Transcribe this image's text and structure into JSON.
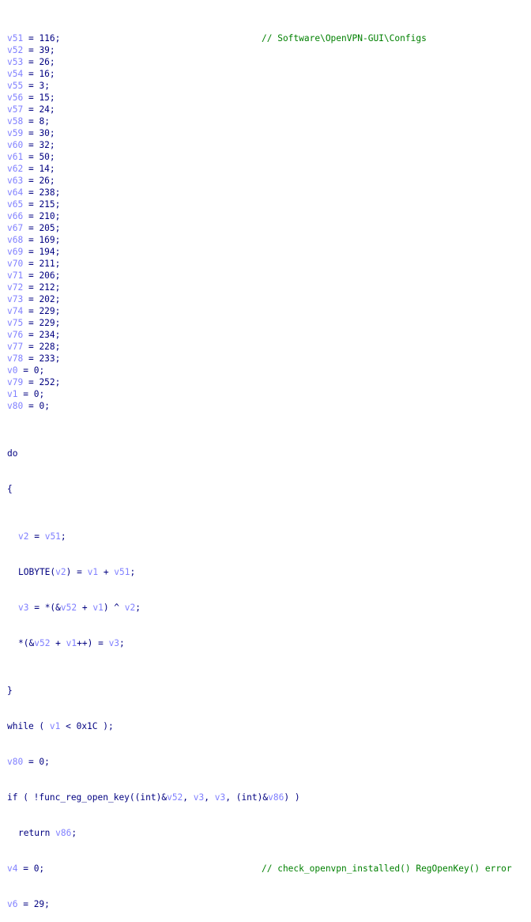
{
  "comments": {
    "configs_path": "// Software\\OpenVPN-GUI\\Configs",
    "regopen_error": "// check_openvpn_installed() RegOpenKey() error"
  },
  "assignments": [
    {
      "var": "v51",
      "value": "116"
    },
    {
      "var": "v52",
      "value": "39"
    },
    {
      "var": "v53",
      "value": "26"
    },
    {
      "var": "v54",
      "value": "16"
    },
    {
      "var": "v55",
      "value": "3"
    },
    {
      "var": "v56",
      "value": "15"
    },
    {
      "var": "v57",
      "value": "24"
    },
    {
      "var": "v58",
      "value": "8"
    },
    {
      "var": "v59",
      "value": "30"
    },
    {
      "var": "v60",
      "value": "32"
    },
    {
      "var": "v61",
      "value": "50"
    },
    {
      "var": "v62",
      "value": "14"
    },
    {
      "var": "v63",
      "value": "26"
    },
    {
      "var": "v64",
      "value": "238"
    },
    {
      "var": "v65",
      "value": "215"
    },
    {
      "var": "v66",
      "value": "210"
    },
    {
      "var": "v67",
      "value": "205"
    },
    {
      "var": "v68",
      "value": "169"
    },
    {
      "var": "v69",
      "value": "194"
    },
    {
      "var": "v70",
      "value": "211"
    },
    {
      "var": "v71",
      "value": "206"
    },
    {
      "var": "v72",
      "value": "212"
    },
    {
      "var": "v73",
      "value": "202"
    },
    {
      "var": "v74",
      "value": "229"
    },
    {
      "var": "v75",
      "value": "229"
    },
    {
      "var": "v76",
      "value": "234"
    },
    {
      "var": "v77",
      "value": "228"
    },
    {
      "var": "v78",
      "value": "233"
    },
    {
      "var": "v0",
      "value": "0"
    },
    {
      "var": "v79",
      "value": "252"
    },
    {
      "var": "v1",
      "value": "0"
    },
    {
      "var": "v80",
      "value": "0"
    }
  ],
  "loop": {
    "do": "do",
    "open_brace": "{",
    "close_brace": "}",
    "body": [
      "v2 = v51;",
      "LOBYTE(v2) = v1 + v51;",
      "v3 = *(&v52 + v1) ^ v2;",
      "*(&v52 + v1++) = v3;"
    ],
    "while": "while ( v1 < 0x1C );"
  },
  "tail": [
    "v80 = 0;",
    "if ( !func_reg_open_key((int)&v52, v3, v3, (int)&v86) )",
    "  return v86;",
    "v4 = 0;",
    "v6 = 29;"
  ],
  "colors": {
    "variable": "#8080ff",
    "code": "#000080",
    "comment": "#008000",
    "background": "#ffffff"
  }
}
